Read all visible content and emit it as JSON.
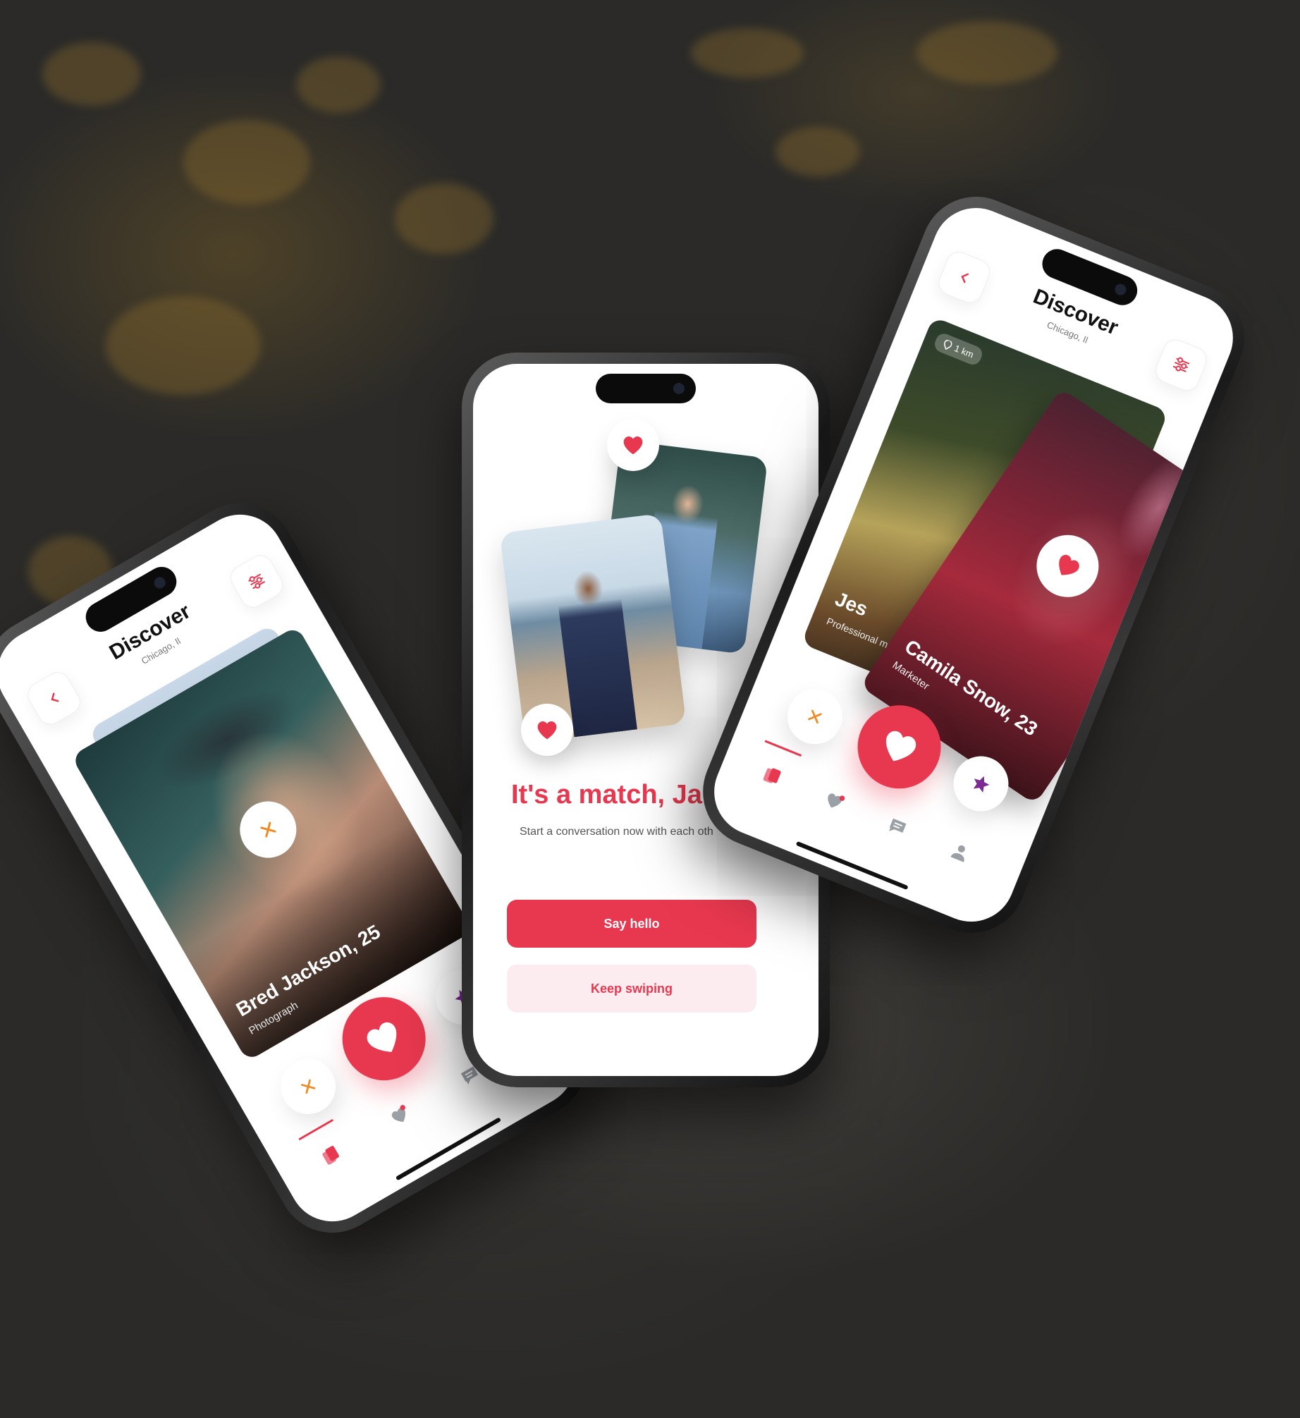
{
  "colors": {
    "accent": "#e8384f",
    "accent_soft": "#fdecef",
    "star": "#7b2a93",
    "dismiss": "#f08a24"
  },
  "left_phone": {
    "header": {
      "title": "Discover",
      "subtitle": "Chicago, Il",
      "back_icon": "chevron-left-icon",
      "filter_icon": "sliders-icon"
    },
    "card": {
      "name": "Bred Jackson, 25",
      "job": "Photograph"
    },
    "actions": {
      "dismiss_icon": "close-icon",
      "like_icon": "heart-icon",
      "superlike_icon": "star-icon"
    },
    "tabs": [
      "cards-icon",
      "matches-icon",
      "chat-icon"
    ]
  },
  "center_phone": {
    "title": "It's a match, Jak",
    "subtitle": "Start a conversation now with each oth",
    "primary_button": "Say hello",
    "secondary_button": "Keep swiping"
  },
  "right_phone": {
    "header": {
      "title": "Discover",
      "subtitle": "Chicago, Il",
      "back_icon": "chevron-left-icon",
      "filter_icon": "sliders-icon"
    },
    "back_card": {
      "name": "Jes",
      "job": "Professional model",
      "distance": "1 km"
    },
    "front_card": {
      "name": "Camila Snow, 23",
      "job": "Marketer"
    },
    "actions": {
      "dismiss_icon": "close-icon",
      "like_icon": "heart-icon",
      "superlike_icon": "star-icon"
    },
    "tabs": [
      "cards-icon",
      "matches-icon",
      "chat-icon",
      "profile-icon"
    ]
  }
}
